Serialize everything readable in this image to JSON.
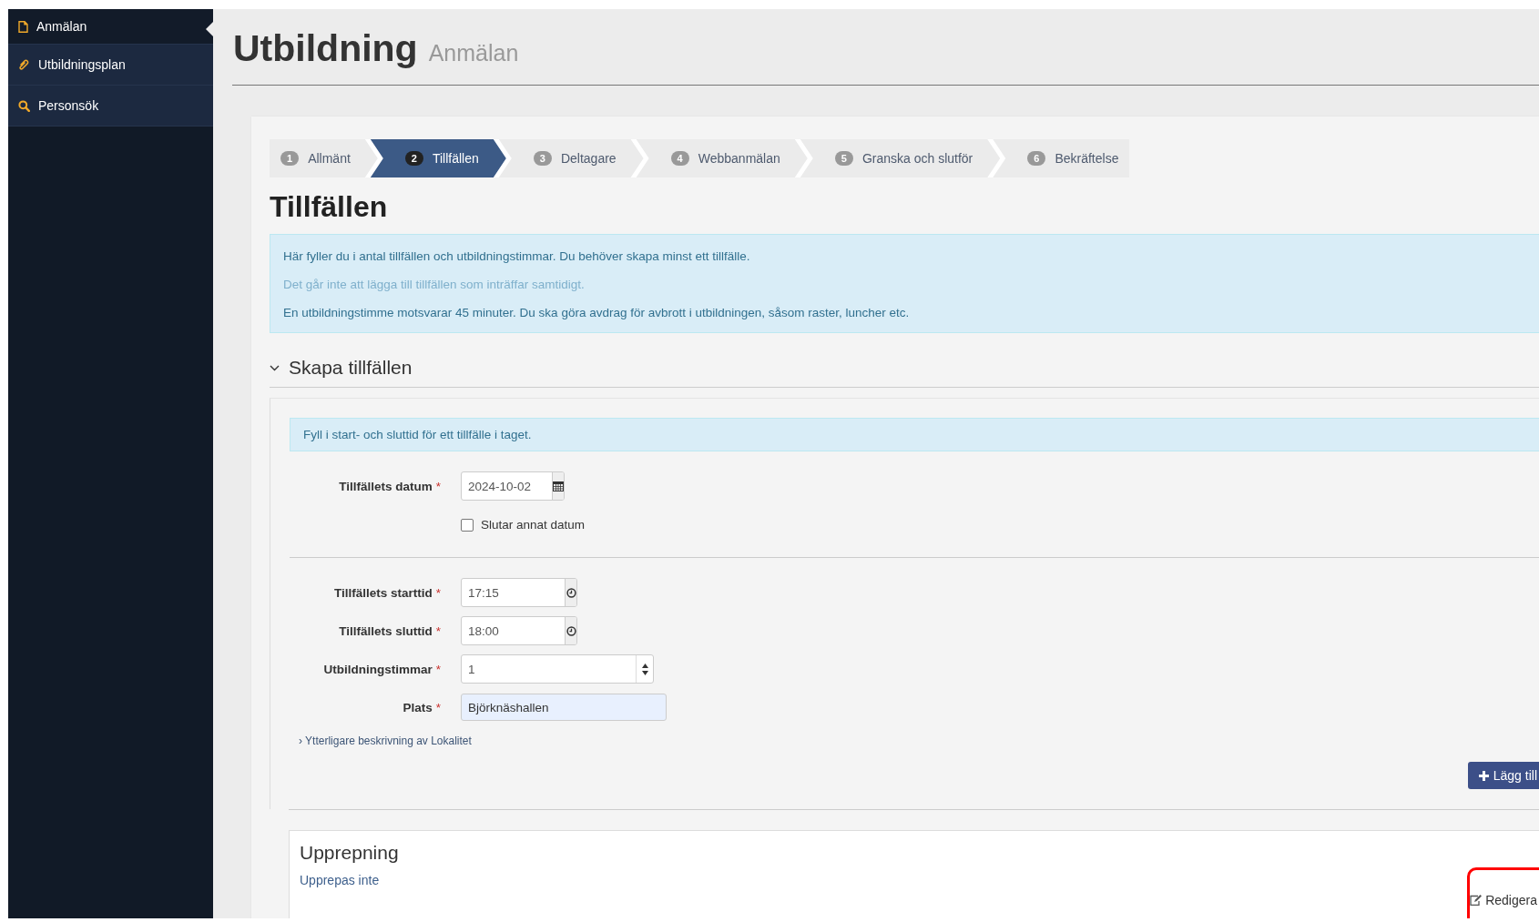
{
  "sidebar": {
    "items": [
      {
        "label": "Anmälan",
        "selected": true
      },
      {
        "label": "Utbildningsplan",
        "selected": false
      },
      {
        "label": "Personsök",
        "selected": false
      }
    ]
  },
  "page_header": {
    "title": "Utbildning",
    "subtitle": "Anmälan"
  },
  "steps": [
    {
      "number": "1",
      "label": "Allmänt",
      "selected": false
    },
    {
      "number": "2",
      "label": "Tillfällen",
      "selected": true
    },
    {
      "number": "3",
      "label": "Deltagare",
      "selected": false
    },
    {
      "number": "4",
      "label": "Webbanmälan",
      "selected": false
    },
    {
      "number": "5",
      "label": "Granska och slutför",
      "selected": false
    },
    {
      "number": "6",
      "label": "Bekräftelse",
      "selected": false
    }
  ],
  "section_title": "Tillfällen",
  "info_lines": [
    {
      "text": "Här fyller du i antal tillfällen och utbildningstimmar. Du behöver skapa minst ett tillfälle.",
      "muted": false
    },
    {
      "text": "Det går inte att lägga till tillfällen som inträffar samtidigt.",
      "muted": true
    },
    {
      "text": "En utbildningstimme motsvarar 45 minuter. Du ska göra avdrag för avbrott i utbildningen, såsom raster, luncher etc.",
      "muted": false
    }
  ],
  "create_section": {
    "title": "Skapa tillfällen",
    "expanded": true,
    "hint": "Fyll i start- och sluttid för ett tillfälle i taget.",
    "date_field": {
      "label": "Tillfällets datum",
      "required_mark": "*",
      "value": "2024-10-02"
    },
    "other_date": {
      "label": "Slutar annat datum",
      "checked": false
    },
    "fields": [
      {
        "kind": "time",
        "label": "Tillfällets starttid",
        "required_mark": "*",
        "value": "17:15"
      },
      {
        "kind": "time",
        "label": "Tillfällets sluttid",
        "required_mark": "*",
        "value": "18:00"
      },
      {
        "kind": "number",
        "label": "Utbildningstimmar",
        "required_mark": "*",
        "value": "1"
      },
      {
        "kind": "text",
        "label": "Plats",
        "required_mark": "*",
        "value": "Björknäshallen"
      }
    ],
    "more_link": "› Ytterligare beskrivning av Lokalitet",
    "add_button": "Lägg till"
  },
  "repeat": {
    "title": "Upprepning",
    "value": "Upprepas inte",
    "edit": "Redigera",
    "highlighted": true
  }
}
